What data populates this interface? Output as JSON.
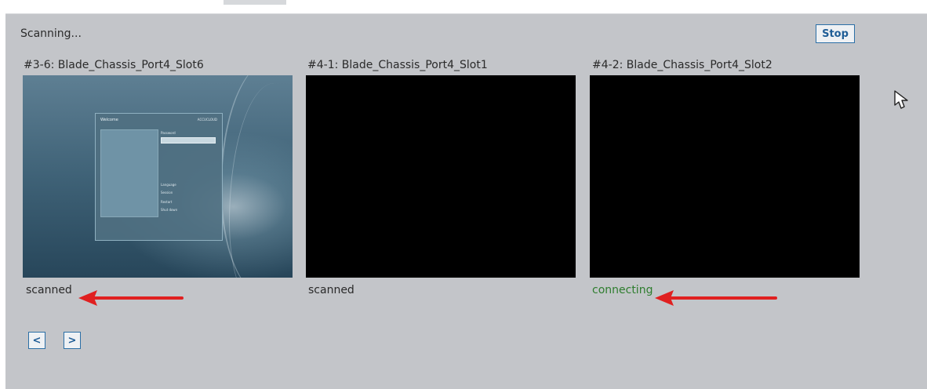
{
  "header": {
    "status_text": "Scanning...",
    "stop_label": "Stop"
  },
  "slots": [
    {
      "title": "#3-6: Blade_Chassis_Port4_Slot6",
      "state": "scanned",
      "screen": "desktop-thumbnail"
    },
    {
      "title": "#4-1: Blade_Chassis_Port4_Slot1",
      "state": "scanned",
      "screen": "black"
    },
    {
      "title": "#4-2: Blade_Chassis_Port4_Slot2",
      "state": "connecting",
      "screen": "black"
    }
  ],
  "thumbnail": {
    "window_title": "Welcome",
    "window_brand": "ACCUCLOUD",
    "field_label": "Password",
    "options": [
      "Language",
      "Session",
      "Restart",
      "Shut down"
    ]
  },
  "pagination": {
    "prev_label": "<",
    "next_label": ">"
  },
  "colors": {
    "panel_bg": "#c3c5c9",
    "button_border": "#2b6fa6",
    "connecting_text": "#2e7d2e",
    "annotation_arrow": "#e02020"
  },
  "icons": [
    "arrow-pointer-icon",
    "red-annotation-arrow-icon"
  ]
}
